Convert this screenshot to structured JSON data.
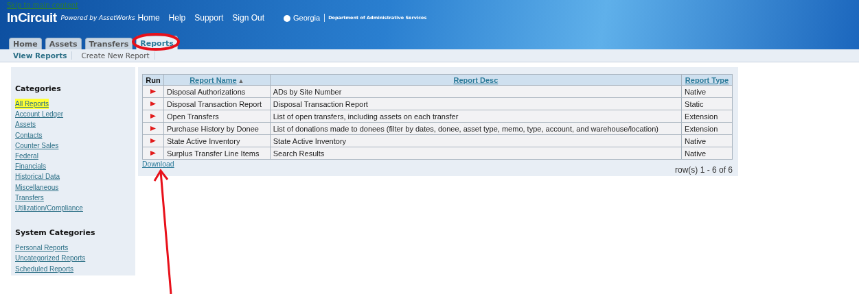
{
  "header": {
    "skip_link": "Skip to main content",
    "logo": "InCircuit",
    "powered_by": "Powered by AssetWorks",
    "nav": [
      "Home",
      "Help",
      "Support",
      "Sign Out"
    ],
    "state_logo": "Georgia",
    "department": "Department of Administrative Services"
  },
  "tabs": [
    {
      "label": "Home",
      "selected": false
    },
    {
      "label": "Assets",
      "selected": false
    },
    {
      "label": "Transfers",
      "selected": false
    },
    {
      "label": "Reports",
      "selected": true
    }
  ],
  "subtabs": [
    {
      "label": "View Reports",
      "selected": true
    },
    {
      "label": "Create New Report",
      "selected": false
    }
  ],
  "sidebar": {
    "sections": [
      {
        "title": "Categories",
        "items": [
          {
            "label": "All Reports",
            "selected": true
          },
          {
            "label": "Account Ledger",
            "selected": false
          },
          {
            "label": "Assets",
            "selected": false
          },
          {
            "label": "Contacts",
            "selected": false
          },
          {
            "label": "Counter Sales",
            "selected": false
          },
          {
            "label": "Federal",
            "selected": false
          },
          {
            "label": "Financials",
            "selected": false
          },
          {
            "label": "Historical Data",
            "selected": false
          },
          {
            "label": "Miscellaneous",
            "selected": false
          },
          {
            "label": "Transfers",
            "selected": false
          },
          {
            "label": "Utilization/Compliance",
            "selected": false
          }
        ]
      },
      {
        "title": "System Categories",
        "items": [
          {
            "label": "Personal Reports",
            "selected": false
          },
          {
            "label": "Uncategorized Reports",
            "selected": false
          },
          {
            "label": "Scheduled Reports",
            "selected": false
          }
        ]
      }
    ]
  },
  "table": {
    "columns": [
      {
        "label": "Run",
        "kind": "plain"
      },
      {
        "label": "Report Name",
        "kind": "link",
        "sort": "▲"
      },
      {
        "label": "Report Desc",
        "kind": "link"
      },
      {
        "label": "Report Type",
        "kind": "link"
      }
    ],
    "rows": [
      {
        "name": "Disposal Authorizations",
        "desc": "ADs by Site Number",
        "type": "Native"
      },
      {
        "name": "Disposal Transaction Report",
        "desc": "Disposal Transaction Report",
        "type": "Static"
      },
      {
        "name": "Open Transfers",
        "desc": "List of open transfers, including assets on each transfer",
        "type": "Extension"
      },
      {
        "name": "Purchase History by Donee",
        "desc": "List of donations made to donees (filter by dates, donee, asset type, memo, type, account, and warehouse/location)",
        "type": "Extension"
      },
      {
        "name": "State Active Inventory",
        "desc": "State Active Inventory",
        "type": "Native"
      },
      {
        "name": "Surplus Transfer Line Items",
        "desc": "Search Results",
        "type": "Native"
      }
    ],
    "download": "Download",
    "pager": "row(s) 1 - 6 of 6"
  }
}
